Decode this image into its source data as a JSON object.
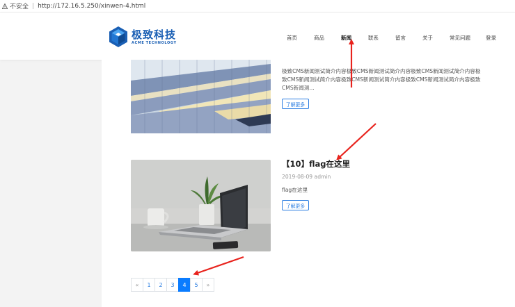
{
  "browser": {
    "security_label": "不安全",
    "url": "http://172.16.5.250/xinwen-4.html"
  },
  "brand": {
    "name_cn": "极致科技",
    "name_en": "ACME TECHNOLOGY",
    "color": "#1a5fb4"
  },
  "nav": {
    "items": [
      {
        "label": "首页",
        "active": false
      },
      {
        "label": "商品",
        "active": false
      },
      {
        "label": "新闻",
        "active": true
      },
      {
        "label": "联系",
        "active": false
      },
      {
        "label": "留言",
        "active": false
      },
      {
        "label": "关于",
        "active": false
      },
      {
        "label": "常见问题",
        "active": false
      },
      {
        "label": "登录",
        "active": false
      }
    ]
  },
  "articles": [
    {
      "summary": "极致CMS新闻测试简介内容极致CMS新闻测试简介内容极致CMS新闻测试简介内容极致CMS新闻测试简介内容极致CMS新闻测试简介内容极致CMS新闻测试简介内容极致CMS新闻测...",
      "button": "了解更多",
      "image": "building-icon"
    },
    {
      "title": "【10】flag在这里",
      "meta": "2019-08-09 admin",
      "summary": "flag在这里",
      "button": "了解更多",
      "image": "laptop-icon"
    }
  ],
  "pagination": {
    "prev": "«",
    "pages": [
      "1",
      "2",
      "3",
      "4",
      "5"
    ],
    "current": "4",
    "next": "»",
    "active_color": "#0a7cff"
  },
  "annotation_color": "#e8231d"
}
